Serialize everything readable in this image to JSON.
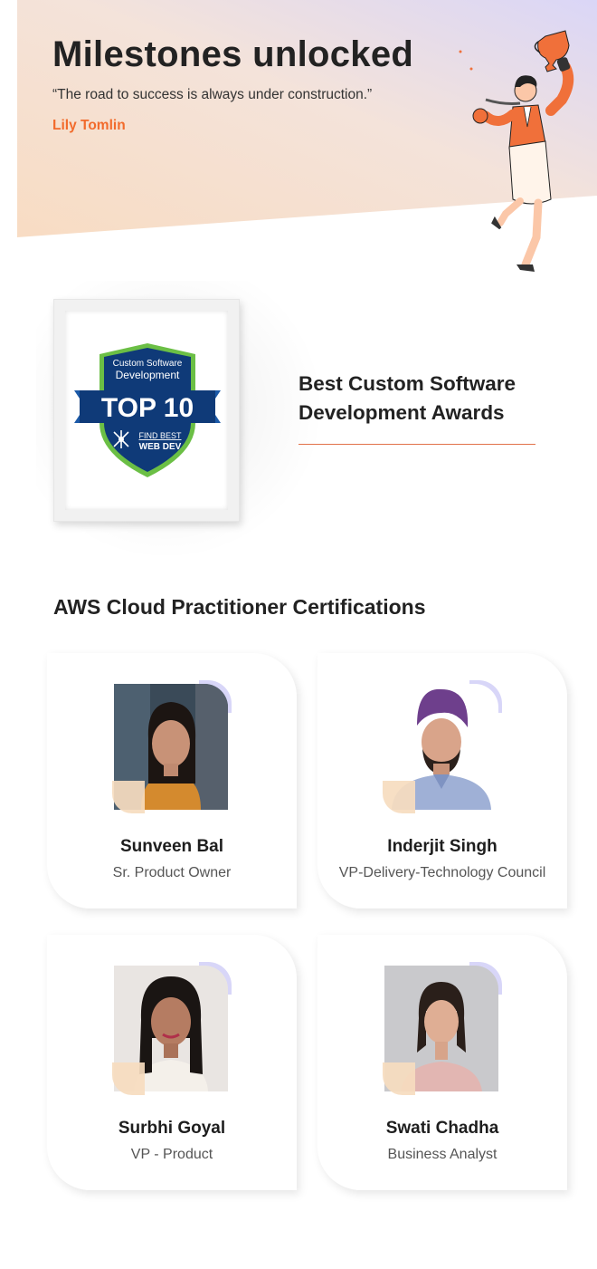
{
  "hero": {
    "title": "Milestones unlocked",
    "quote": "“The road to success is always under construction.”",
    "author": "Lily Tomlin",
    "illustration_icon": "trophy-celebrating-person-illustration"
  },
  "award": {
    "badge": {
      "line1": "Custom Software",
      "line2": "Development",
      "rank": "TOP 10",
      "brand_top": "FIND BEST",
      "brand_bottom": "WEB DEV"
    },
    "title_line1": "Best Custom Software",
    "title_line2": "Development Awards"
  },
  "certifications": {
    "title": "AWS Cloud Practitioner Certifications",
    "people": [
      {
        "name": "Sunveen Bal",
        "role": "Sr. Product Owner"
      },
      {
        "name": "Inderjit Singh",
        "role": "VP-Delivery-Technology Council"
      },
      {
        "name": "Surbhi Goyal",
        "role": "VP - Product"
      },
      {
        "name": "Swati Chadha",
        "role": "Business Analyst"
      }
    ]
  },
  "colors": {
    "accent_orange": "#f26b2c",
    "divider": "#e2724a",
    "hero_gradient_start": "#f7dcc4",
    "hero_gradient_end": "#dcd7f6",
    "card_accent_purple": "#d8d6f8",
    "card_accent_peach": "#f6dcbf",
    "badge_navy": "#0f3a78",
    "badge_green": "#6bbf45"
  }
}
